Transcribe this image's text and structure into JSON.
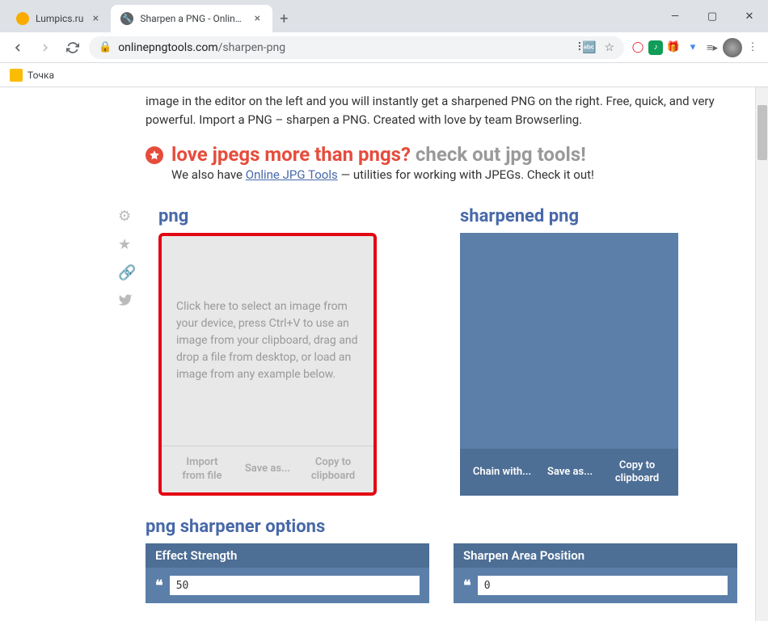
{
  "tabs": [
    {
      "title": "Lumpics.ru",
      "active": false,
      "favicon": "#f9ab00"
    },
    {
      "title": "Sharpen a PNG - Online PNG Too",
      "active": true,
      "favicon": "#5f6368"
    }
  ],
  "url": {
    "host": "onlinepngtools.com",
    "path": "/sharpen-png"
  },
  "bookmark": {
    "label": "Точка"
  },
  "intro": "image in the editor on the left and you will instantly get a sharpened PNG on the right. Free, quick, and very powerful. Import a PNG – sharpen a PNG. Created with love by team Browserling.",
  "promo": {
    "badge": "!",
    "headline_red": "love jpegs more than pngs?",
    "headline_grey": " check out jpg tools!",
    "sub_prefix": "We also have ",
    "sub_link": "Online JPG Tools",
    "sub_suffix": " — utilities for working with JPEGs. Check it out!"
  },
  "panels": {
    "input": {
      "title": "png",
      "placeholder": "Click here to select an image from your device, press Ctrl+V to use an image from your clipboard, drag and drop a file from desktop, or load an image from any example below.",
      "actions": [
        "Import from file",
        "Save as...",
        "Copy to clipboard"
      ]
    },
    "output": {
      "title": "sharpened png",
      "actions": [
        "Chain with...",
        "Save as...",
        "Copy to clipboard"
      ]
    }
  },
  "options": {
    "title": "png sharpener options",
    "cols": [
      {
        "label": "Effect Strength",
        "value": "50"
      },
      {
        "label": "Sharpen Area Position",
        "value": "0"
      }
    ]
  }
}
